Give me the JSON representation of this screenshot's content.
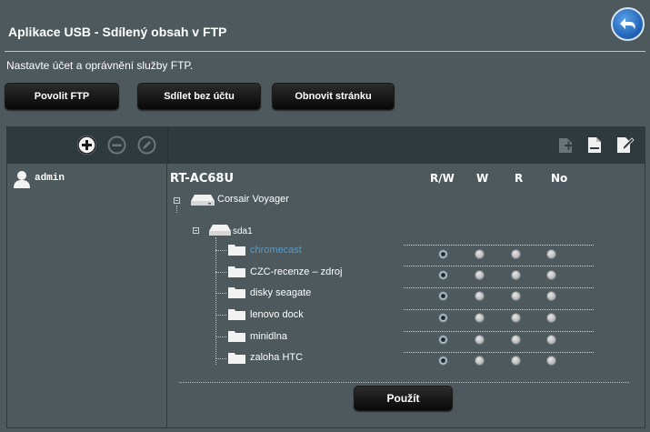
{
  "header": {
    "title": "Aplikace USB - Sdílený obsah v FTP",
    "subtitle": "Nastavte účet a oprávnění služby FTP."
  },
  "actions": {
    "enable_ftp": "Povolit FTP",
    "share_no_account": "Sdílet bez účtu",
    "refresh": "Obnovit stránku",
    "apply": "Použít"
  },
  "accounts": [
    {
      "name": "admin"
    }
  ],
  "tree": {
    "router": "RT-AC68U",
    "device": "Corsair Voyager",
    "partition": "sda1",
    "folders": [
      {
        "name": "chromecast",
        "perm": "R/W",
        "selected": true
      },
      {
        "name": "CZC-recenze – zdroj",
        "perm": "R/W",
        "selected": false
      },
      {
        "name": "disky seagate",
        "perm": "R/W",
        "selected": false
      },
      {
        "name": "lenovo dock",
        "perm": "R/W",
        "selected": false
      },
      {
        "name": "minidlna",
        "perm": "R/W",
        "selected": false
      },
      {
        "name": "zaloha HTC",
        "perm": "R/W",
        "selected": false
      }
    ]
  },
  "permission_columns": [
    "R/W",
    "W",
    "R",
    "No"
  ],
  "colors": {
    "background": "#4d595d",
    "toolbar": "#2f3a3e",
    "selected_folder": "#569ac7"
  },
  "icons": {
    "back": "back-arrow-icon",
    "add_user": "plus-circle-icon",
    "remove_user": "minus-circle-icon",
    "edit_user": "edit-circle-icon",
    "new_folder": "add-folder-icon",
    "delete_folder": "delete-folder-icon",
    "rename_folder": "rename-folder-icon"
  }
}
